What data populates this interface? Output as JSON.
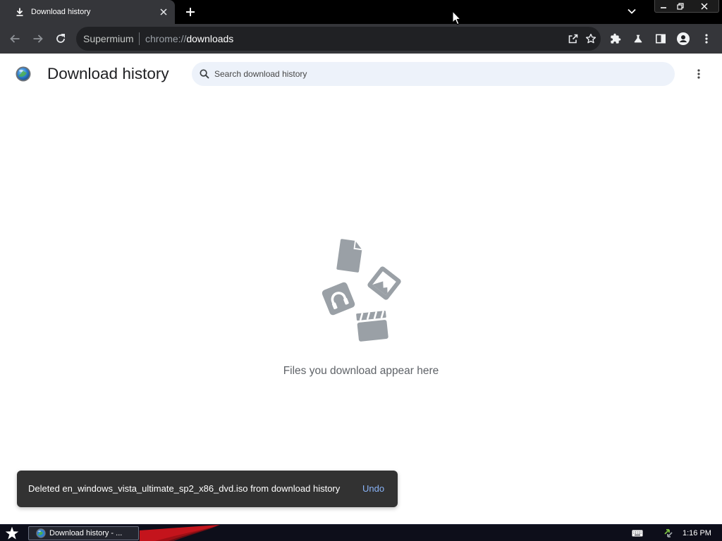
{
  "colors": {
    "tabstrip_bg": "#000000",
    "toolbar_bg": "#35363a",
    "omnibox_bg": "#202124",
    "search_bg": "#edf2fa",
    "toast_bg": "#323232",
    "accent": "#8ab4f8",
    "illustration": "#9aa0a6",
    "taskbar_bg": "#0d0e1a"
  },
  "pointer": "mouse-pointer-icon",
  "browser": {
    "tabs": [
      {
        "title": "Download history",
        "icon": "download-icon",
        "close_icon": "close-icon",
        "active": true
      }
    ],
    "new_tab_icon": "plus-icon",
    "tab_search_icon": "chevron-down-icon",
    "window_controls": [
      "minimize-icon",
      "restore-icon",
      "close-icon"
    ],
    "toolbar": {
      "back_icon": "arrow-left-icon",
      "forward_icon": "arrow-right-icon",
      "reload_icon": "reload-icon",
      "omnibox": {
        "origin_chip": "Supermium",
        "url_scheme": "chrome://",
        "url_host": "downloads",
        "share_icon": "share-icon",
        "bookmark_icon": "star-icon"
      },
      "actions": [
        "puzzle-icon",
        "flask-icon",
        "side-panel-icon",
        "profile-avatar-icon",
        "more-vert-icon"
      ]
    }
  },
  "page": {
    "header": {
      "logo": "supermium-logo-icon",
      "title": "Download history",
      "search_icon": "search-icon",
      "search_placeholder": "Search download history",
      "menu_icon": "more-vert-icon"
    },
    "empty_state": {
      "illustration": [
        "document-icon",
        "image-icon",
        "headphones-icon",
        "clapperboard-icon"
      ],
      "message": "Files you download appear here"
    },
    "toast": {
      "message": "Deleted en_windows_vista_ultimate_sp2_x86_dvd.iso from download history",
      "action_label": "Undo"
    }
  },
  "taskbar": {
    "start_icon": "start-star-icon",
    "buttons": [
      {
        "label": "Download history - ...",
        "icon": "globe-icon",
        "active": true
      }
    ],
    "tray": {
      "keyboard_icon": "keyboard-icon",
      "network_icon": "network-icon",
      "clock": "1:16 PM"
    }
  }
}
